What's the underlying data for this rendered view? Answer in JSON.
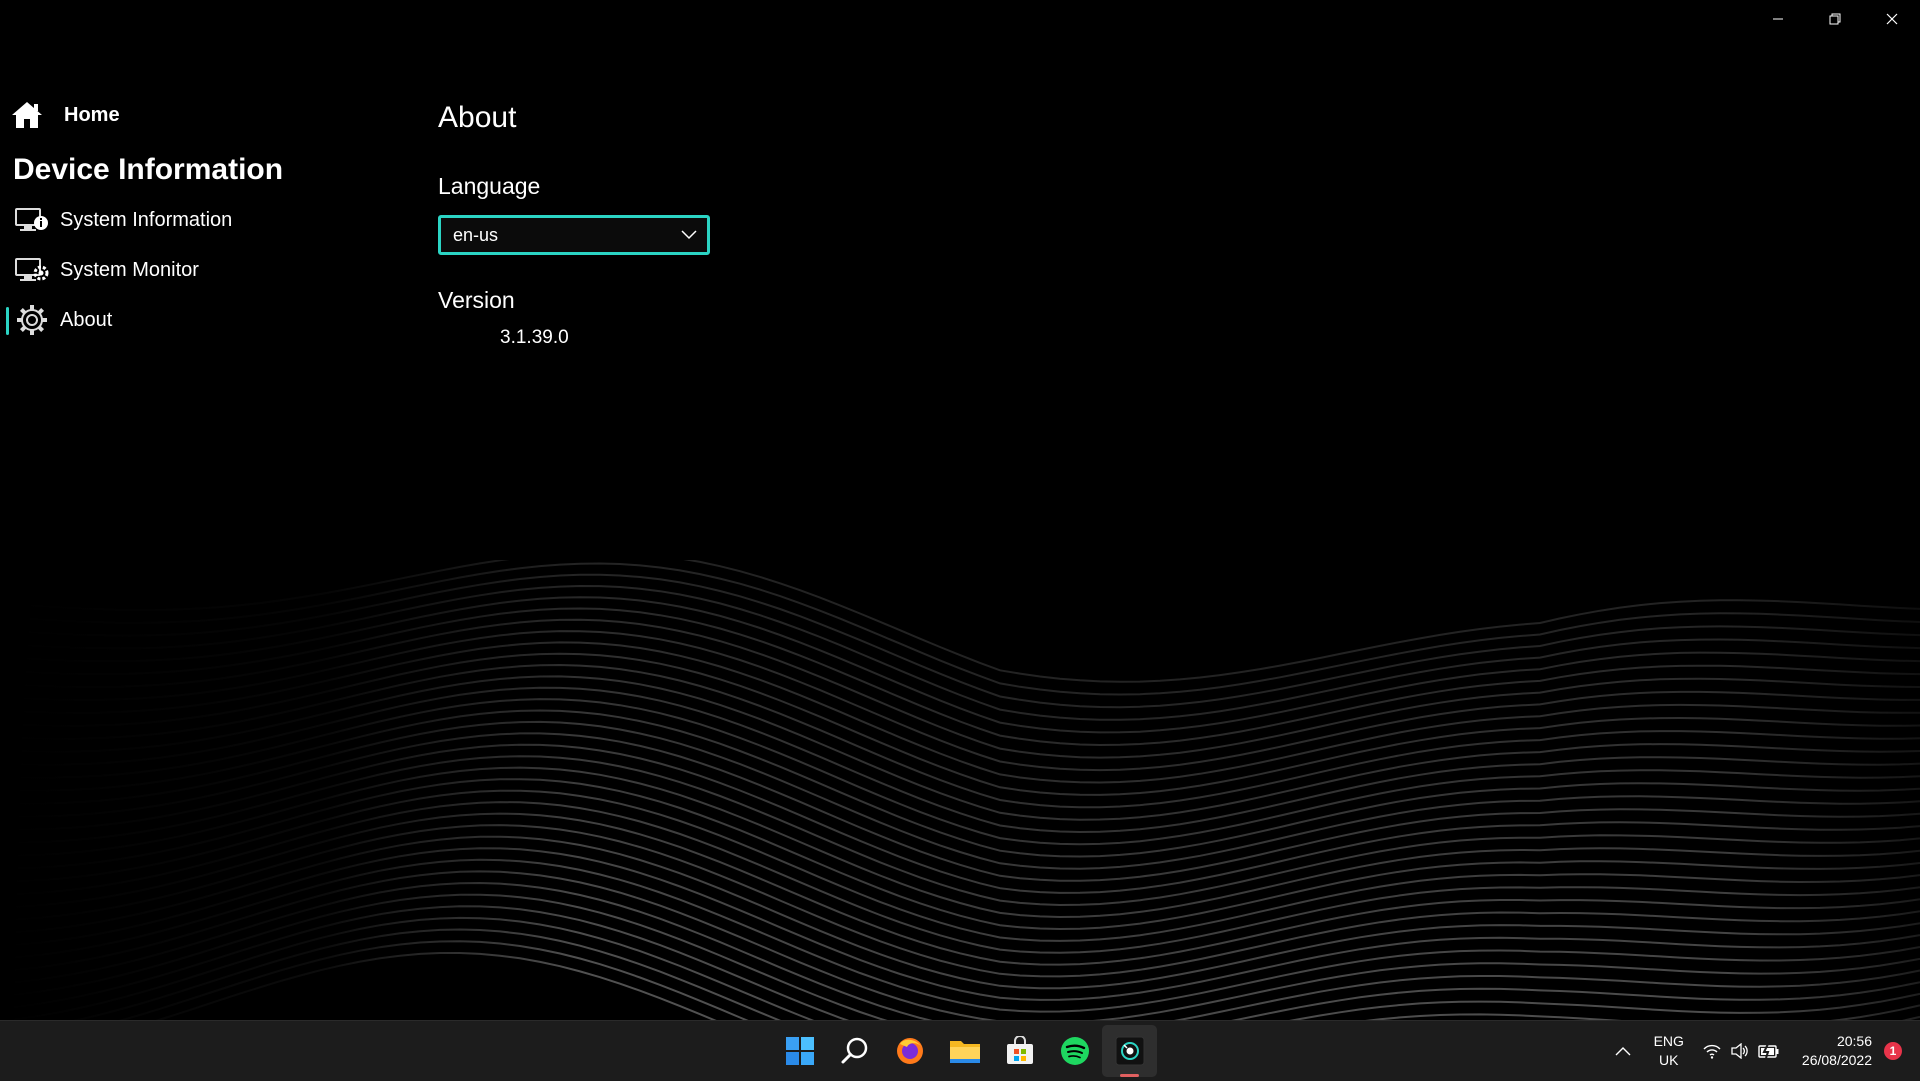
{
  "sidebar": {
    "home_label": "Home",
    "section_title": "Device Information",
    "items": [
      {
        "label": "System Information",
        "icon": "monitor-info-icon"
      },
      {
        "label": "System Monitor",
        "icon": "monitor-gear-icon"
      },
      {
        "label": "About",
        "icon": "gear-icon",
        "active": true
      }
    ]
  },
  "main": {
    "title": "About",
    "language_label": "Language",
    "language_value": "en-us",
    "version_label": "Version",
    "version_value": "3.1.39.0"
  },
  "taskbar": {
    "apps": [
      "windows-start-icon",
      "search-icon",
      "firefox-icon",
      "file-explorer-icon",
      "microsoft-store-icon",
      "spotify-icon",
      "device-information-app-icon"
    ],
    "lang_line1": "ENG",
    "lang_line2": "UK",
    "time": "20:56",
    "date": "26/08/2022",
    "notification_count": "1"
  },
  "colors": {
    "accent": "#2bd4c4",
    "background": "#000000",
    "taskbar": "#1c1c1c"
  }
}
